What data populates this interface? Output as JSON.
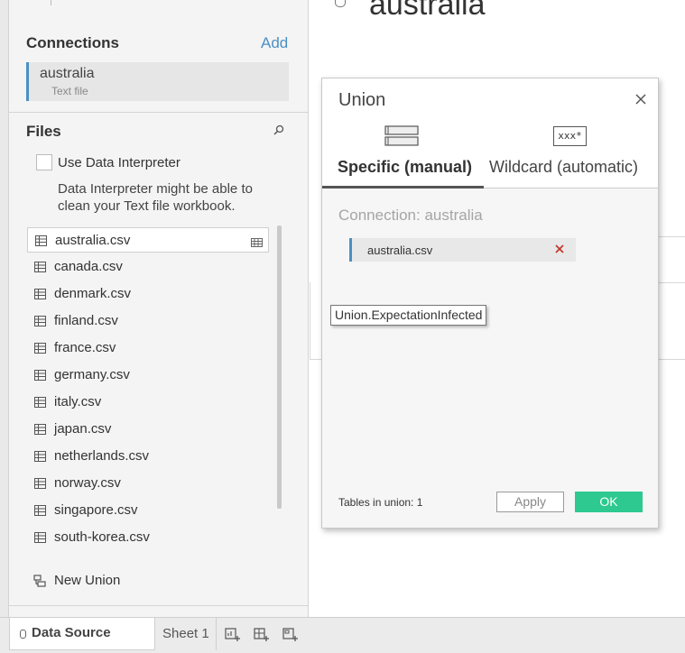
{
  "left_panel": {
    "connections_title": "Connections",
    "add_label": "Add",
    "connection": {
      "name": "australia",
      "type": "Text file"
    },
    "files_title": "Files",
    "use_interpreter_label": "Use Data Interpreter",
    "interpreter_text": "Data Interpreter might be able to clean your Text file workbook.",
    "files": [
      "australia.csv",
      "canada.csv",
      "denmark.csv",
      "finland.csv",
      "france.csv",
      "germany.csv",
      "italy.csv",
      "japan.csv",
      "netherlands.csv",
      "norway.csv",
      "singapore.csv",
      "south-korea.csv"
    ],
    "new_union_label": "New Union"
  },
  "canvas": {
    "title": "australia"
  },
  "union_dialog": {
    "title": "Union",
    "tabs": {
      "specific": "Specific (manual)",
      "wildcard": "Wildcard (automatic)",
      "wildcard_icon_text": "xxx*"
    },
    "connection_caption": "Connection: australia",
    "tables": [
      "australia.csv"
    ],
    "tables_count_label": "Tables in union: 1",
    "apply_label": "Apply",
    "ok_label": "OK"
  },
  "tooltip": {
    "text": "Union.ExpectationInfected"
  },
  "bottom_bar": {
    "data_source_label": "Data Source",
    "sheet_label": "Sheet 1"
  },
  "colors": {
    "accent_blue": "#4a90c4",
    "ok_green": "#2dc990",
    "remove_red": "#c0392b"
  }
}
